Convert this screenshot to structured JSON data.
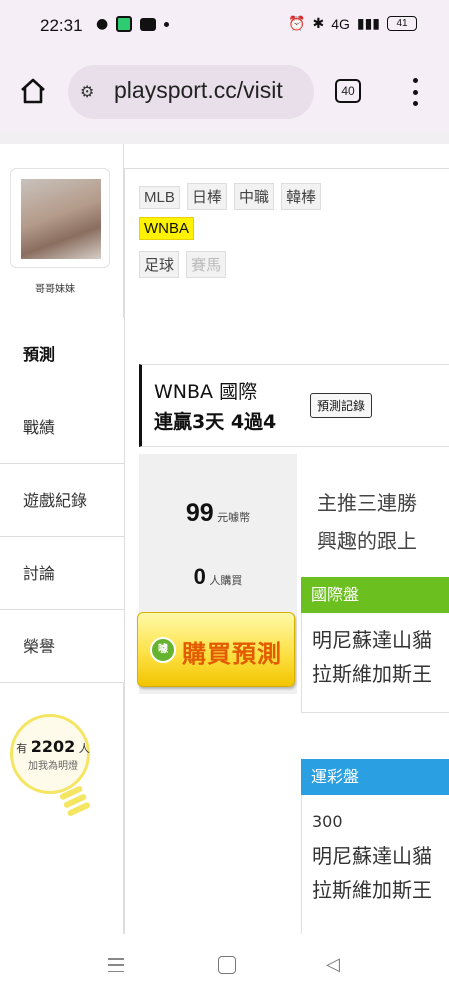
{
  "status_bar": {
    "time": "22:31",
    "signal": "4G",
    "battery": "41"
  },
  "browser": {
    "url": "playsport.cc/visit",
    "tab_count": "40"
  },
  "profile": {
    "name": "哥哥妹妹"
  },
  "sidebar": {
    "items": [
      {
        "label": "預測"
      },
      {
        "label": "戰績"
      },
      {
        "label": "遊戲紀錄"
      },
      {
        "label": "討論"
      },
      {
        "label": "榮譽"
      }
    ],
    "fans": {
      "prefix": "有",
      "count": "2202",
      "suffix": "人",
      "subtitle": "加我為明燈"
    }
  },
  "league_tags": {
    "row1": [
      "MLB",
      "日棒",
      "中職",
      "韓棒"
    ],
    "active": "WNBA",
    "row3": [
      "足球"
    ],
    "disabled": "賽馬"
  },
  "prediction_header": {
    "title": "WNBA 國際",
    "streak": "連贏3天 4過4",
    "record_button": "預測記錄"
  },
  "purchase": {
    "price": "99",
    "price_unit": "元噱幣",
    "buyers": "0",
    "buyers_unit": "人購買",
    "buy_button": "購買預測",
    "icon_text": "噱"
  },
  "recommendation": {
    "line1": "主推三連勝",
    "line2": "興趣的跟上"
  },
  "sections": {
    "international": {
      "title": "國際盤",
      "lines": [
        "明尼蘇達山貓",
        "拉斯維加斯王"
      ]
    },
    "lottery": {
      "title": "運彩盤",
      "number": "300",
      "lines": [
        "明尼蘇達山貓",
        "拉斯維加斯王"
      ]
    }
  }
}
